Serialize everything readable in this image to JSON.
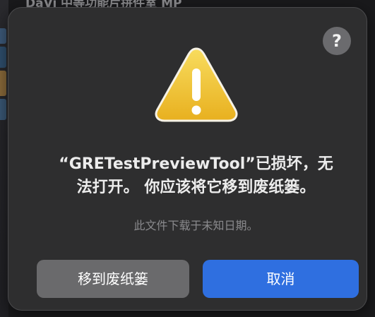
{
  "background": {
    "window_title_partial": "DaVi 中等功能片拼件室 MP"
  },
  "dialog": {
    "help_label": "?",
    "icon": "warning-triangle-icon",
    "title_line1": "“GRETestPreviewTool”已损坏，无",
    "title_line2": "法打开。 你应该将它移到废纸篓。",
    "message": "此文件下载于未知日期。",
    "buttons": {
      "move_to_trash": "移到废纸篓",
      "cancel": "取消"
    }
  },
  "colors": {
    "dialog_bg": "#2e2e2f",
    "primary_button": "#2f6fe0",
    "secondary_button": "#6a6a6c",
    "warning_yellow": "#f3c531"
  }
}
